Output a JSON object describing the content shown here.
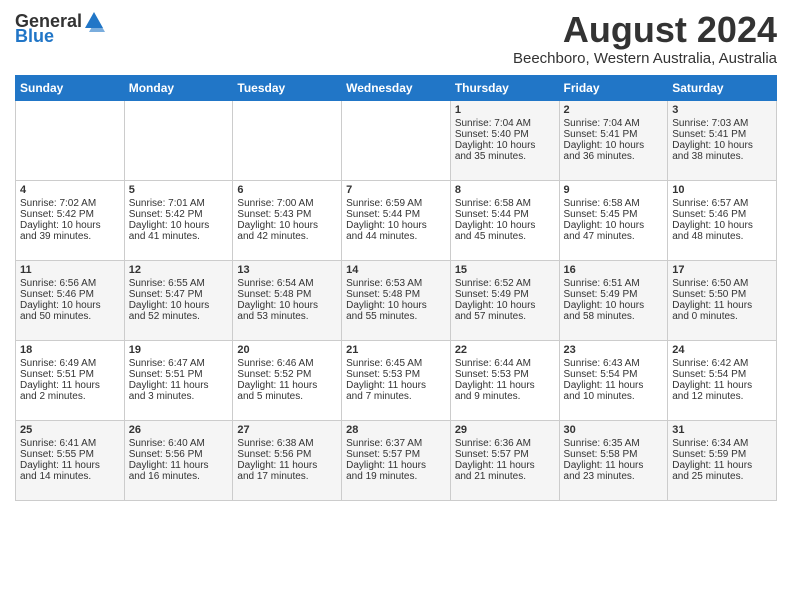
{
  "header": {
    "logo_general": "General",
    "logo_blue": "Blue",
    "title": "August 2024",
    "subtitle": "Beechboro, Western Australia, Australia"
  },
  "days_of_week": [
    "Sunday",
    "Monday",
    "Tuesday",
    "Wednesday",
    "Thursday",
    "Friday",
    "Saturday"
  ],
  "weeks": [
    [
      {
        "day": "",
        "content": ""
      },
      {
        "day": "",
        "content": ""
      },
      {
        "day": "",
        "content": ""
      },
      {
        "day": "",
        "content": ""
      },
      {
        "day": "1",
        "content": "Sunrise: 7:04 AM\nSunset: 5:40 PM\nDaylight: 10 hours\nand 35 minutes."
      },
      {
        "day": "2",
        "content": "Sunrise: 7:04 AM\nSunset: 5:41 PM\nDaylight: 10 hours\nand 36 minutes."
      },
      {
        "day": "3",
        "content": "Sunrise: 7:03 AM\nSunset: 5:41 PM\nDaylight: 10 hours\nand 38 minutes."
      }
    ],
    [
      {
        "day": "4",
        "content": "Sunrise: 7:02 AM\nSunset: 5:42 PM\nDaylight: 10 hours\nand 39 minutes."
      },
      {
        "day": "5",
        "content": "Sunrise: 7:01 AM\nSunset: 5:42 PM\nDaylight: 10 hours\nand 41 minutes."
      },
      {
        "day": "6",
        "content": "Sunrise: 7:00 AM\nSunset: 5:43 PM\nDaylight: 10 hours\nand 42 minutes."
      },
      {
        "day": "7",
        "content": "Sunrise: 6:59 AM\nSunset: 5:44 PM\nDaylight: 10 hours\nand 44 minutes."
      },
      {
        "day": "8",
        "content": "Sunrise: 6:58 AM\nSunset: 5:44 PM\nDaylight: 10 hours\nand 45 minutes."
      },
      {
        "day": "9",
        "content": "Sunrise: 6:58 AM\nSunset: 5:45 PM\nDaylight: 10 hours\nand 47 minutes."
      },
      {
        "day": "10",
        "content": "Sunrise: 6:57 AM\nSunset: 5:46 PM\nDaylight: 10 hours\nand 48 minutes."
      }
    ],
    [
      {
        "day": "11",
        "content": "Sunrise: 6:56 AM\nSunset: 5:46 PM\nDaylight: 10 hours\nand 50 minutes."
      },
      {
        "day": "12",
        "content": "Sunrise: 6:55 AM\nSunset: 5:47 PM\nDaylight: 10 hours\nand 52 minutes."
      },
      {
        "day": "13",
        "content": "Sunrise: 6:54 AM\nSunset: 5:48 PM\nDaylight: 10 hours\nand 53 minutes."
      },
      {
        "day": "14",
        "content": "Sunrise: 6:53 AM\nSunset: 5:48 PM\nDaylight: 10 hours\nand 55 minutes."
      },
      {
        "day": "15",
        "content": "Sunrise: 6:52 AM\nSunset: 5:49 PM\nDaylight: 10 hours\nand 57 minutes."
      },
      {
        "day": "16",
        "content": "Sunrise: 6:51 AM\nSunset: 5:49 PM\nDaylight: 10 hours\nand 58 minutes."
      },
      {
        "day": "17",
        "content": "Sunrise: 6:50 AM\nSunset: 5:50 PM\nDaylight: 11 hours\nand 0 minutes."
      }
    ],
    [
      {
        "day": "18",
        "content": "Sunrise: 6:49 AM\nSunset: 5:51 PM\nDaylight: 11 hours\nand 2 minutes."
      },
      {
        "day": "19",
        "content": "Sunrise: 6:47 AM\nSunset: 5:51 PM\nDaylight: 11 hours\nand 3 minutes."
      },
      {
        "day": "20",
        "content": "Sunrise: 6:46 AM\nSunset: 5:52 PM\nDaylight: 11 hours\nand 5 minutes."
      },
      {
        "day": "21",
        "content": "Sunrise: 6:45 AM\nSunset: 5:53 PM\nDaylight: 11 hours\nand 7 minutes."
      },
      {
        "day": "22",
        "content": "Sunrise: 6:44 AM\nSunset: 5:53 PM\nDaylight: 11 hours\nand 9 minutes."
      },
      {
        "day": "23",
        "content": "Sunrise: 6:43 AM\nSunset: 5:54 PM\nDaylight: 11 hours\nand 10 minutes."
      },
      {
        "day": "24",
        "content": "Sunrise: 6:42 AM\nSunset: 5:54 PM\nDaylight: 11 hours\nand 12 minutes."
      }
    ],
    [
      {
        "day": "25",
        "content": "Sunrise: 6:41 AM\nSunset: 5:55 PM\nDaylight: 11 hours\nand 14 minutes."
      },
      {
        "day": "26",
        "content": "Sunrise: 6:40 AM\nSunset: 5:56 PM\nDaylight: 11 hours\nand 16 minutes."
      },
      {
        "day": "27",
        "content": "Sunrise: 6:38 AM\nSunset: 5:56 PM\nDaylight: 11 hours\nand 17 minutes."
      },
      {
        "day": "28",
        "content": "Sunrise: 6:37 AM\nSunset: 5:57 PM\nDaylight: 11 hours\nand 19 minutes."
      },
      {
        "day": "29",
        "content": "Sunrise: 6:36 AM\nSunset: 5:57 PM\nDaylight: 11 hours\nand 21 minutes."
      },
      {
        "day": "30",
        "content": "Sunrise: 6:35 AM\nSunset: 5:58 PM\nDaylight: 11 hours\nand 23 minutes."
      },
      {
        "day": "31",
        "content": "Sunrise: 6:34 AM\nSunset: 5:59 PM\nDaylight: 11 hours\nand 25 minutes."
      }
    ]
  ]
}
